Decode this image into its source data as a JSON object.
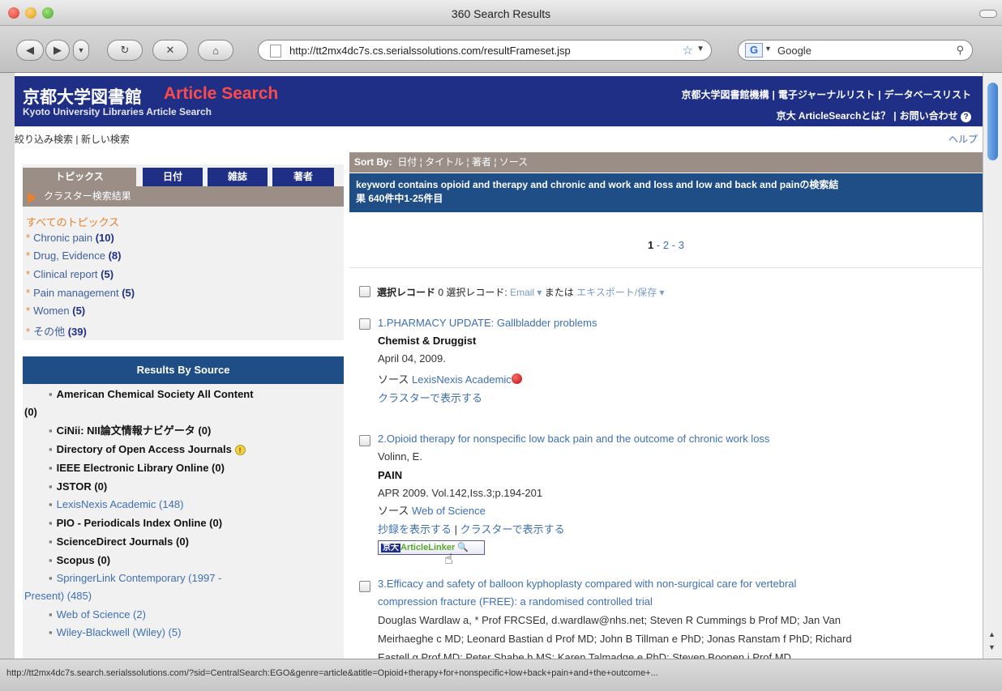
{
  "window": {
    "title": "360 Search Results"
  },
  "browser": {
    "url": "http://tt2mx4dc7s.cs.serialssolutions.com/resultFrameset.jsp",
    "search_placeholder": "Google",
    "status_url": "http://tt2mx4dc7s.search.serialssolutions.com/?sid=CentralSearch:EGO&genre=article&atitle=Opioid+therapy+for+nonspecific+low+back+pain+and+the+outcome+..."
  },
  "header": {
    "logo_jp": "京都大学図書館",
    "logo_en": "Article Search",
    "subtitle": "Kyoto University Libraries Article Search",
    "links_row1": [
      "京都大学図書館機構",
      "電子ジャーナルリスト",
      "データベースリスト"
    ],
    "links_row2": [
      "京大 ArticleSearchとは？",
      "お問い合わせ"
    ]
  },
  "subnav": {
    "refine": "絞り込み検索",
    "new_search": "新しい検索",
    "help": "ヘルプ"
  },
  "topics": {
    "tabs": [
      "トピックス",
      "日付",
      "雑誌",
      "著者"
    ],
    "cluster_label": "クラスター検索結果",
    "all_label": "すべてのトピックス",
    "items": [
      {
        "label": "Chronic pain",
        "count": "(10)"
      },
      {
        "label": "Drug, Evidence",
        "count": "(8)"
      },
      {
        "label": "Clinical report",
        "count": "(5)"
      },
      {
        "label": "Pain management",
        "count": "(5)"
      },
      {
        "label": "Women",
        "count": "(5)"
      },
      {
        "label": "その他",
        "count": "(39)"
      }
    ]
  },
  "sources": {
    "heading": "Results By Source",
    "items": [
      "American Chemical Society All Content",
      "(0)",
      "CiNii: NII論文情報ナビゲータ (0)",
      "Directory of Open Access Journals",
      "IEEE Electronic Library Online (0)",
      "JSTOR (0)",
      "LexisNexis Academic (148)",
      "PIO - Periodicals Index Online (0)",
      "ScienceDirect Journals (0)",
      "Scopus (0)",
      "SpringerLink Contemporary (1997 -",
      "Present) (485)",
      "Web of Science (2)",
      "Wiley-Blackwell (Wiley) (5)"
    ]
  },
  "sort": {
    "label": "Sort By:",
    "options": [
      "日付",
      "タイトル",
      "著者",
      "ソース"
    ]
  },
  "query": {
    "line1": "keyword contains opioid and therapy and chronic and work and loss and low and back and painの検索結",
    "line2": "果 640件中1-25件目"
  },
  "pager": {
    "current": "1",
    "sep": "-",
    "pages": [
      "2",
      "3"
    ]
  },
  "selection": {
    "selected_label": "選択レコード",
    "count": "0",
    "selected_label2": "選択レコード:",
    "email": "Email",
    "or": "または",
    "export": "エキスポート/保存"
  },
  "records": [
    {
      "title": "1.PHARMACY UPDATE: Gallbladder problems",
      "journal": "Chemist & Druggist",
      "date": "April 04, 2009.",
      "source_label": "ソース",
      "source": "LexisNexis Academic",
      "cluster_link": "クラスターで表示する"
    },
    {
      "title": "2.Opioid therapy for nonspecific low back pain and the outcome of chronic work loss",
      "author": "Volinn, E.",
      "journal": "PAIN",
      "date": "APR 2009. Vol.142,Iss.3;p.194-201",
      "source_label": "ソース",
      "source": "Web of Science",
      "abstract_link": "抄録を表示する",
      "cluster_link": "クラスターで表示する",
      "linker_k": "京大",
      "linker_a": "ArticleLinker"
    },
    {
      "title_line1": "3.Efficacy and safety of balloon kyphoplasty compared with non-surgical care for vertebral",
      "title_line2": "compression fracture (FREE): a randomised controlled trial",
      "authors_line1": "Douglas Wardlaw a, * Prof FRCSEd, d.wardlaw@nhs.net; Steven R Cummings b Prof MD; Jan Van",
      "authors_line2": "Meirhaeghe c MD; Leonard Bastian d Prof MD; John B Tillman e PhD; Jonas Ranstam f PhD; Richard",
      "authors_line3": "Eastell g Prof MD; Peter Shabe h MS; Karen Talmadge e PhD; Steven Boonen i Prof MD"
    }
  ]
}
